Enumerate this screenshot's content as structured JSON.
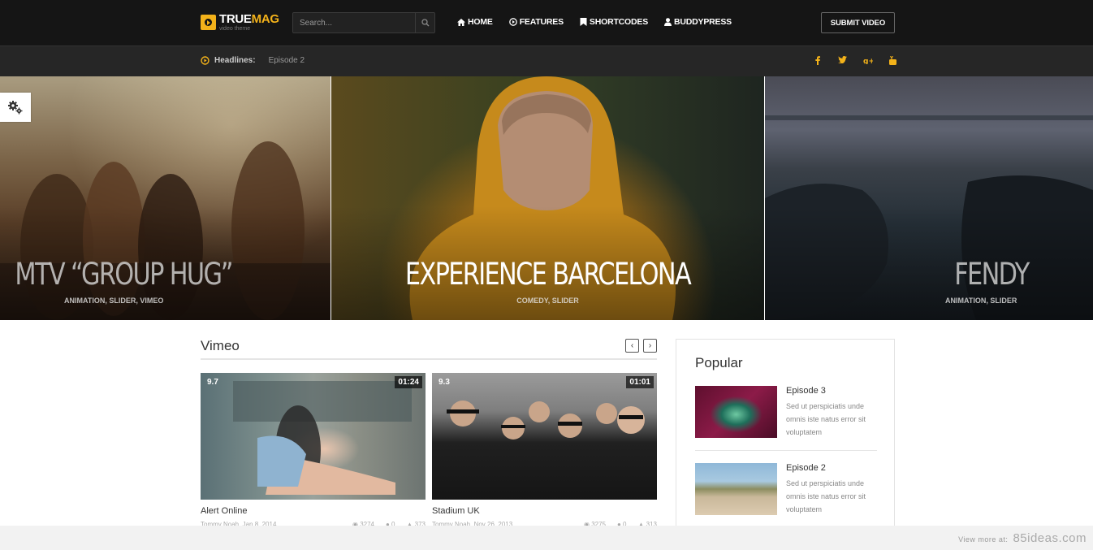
{
  "header": {
    "logo_true": "TRUE",
    "logo_mag": "MAG",
    "logo_tagline": "video theme",
    "search_placeholder": "Search...",
    "nav": [
      {
        "label": "HOME",
        "icon": "home-icon"
      },
      {
        "label": "FEATURES",
        "icon": "play-circle-icon"
      },
      {
        "label": "SHORTCODES",
        "icon": "bookmark-icon"
      },
      {
        "label": "BUDDYPRESS",
        "icon": "user-icon"
      }
    ],
    "submit_label": "SUBMIT VIDEO"
  },
  "headlines": {
    "label": "Headlines:",
    "item": "Episode 2",
    "social": [
      "facebook-icon",
      "twitter-icon",
      "google-plus-icon",
      "youtube-icon"
    ]
  },
  "slider": [
    {
      "title": "MTV “GROUP HUG”",
      "cats": "ANIMATION, SLIDER, VIMEO"
    },
    {
      "title": "EXPERIENCE BARCELONA",
      "cats": "COMEDY, SLIDER"
    },
    {
      "title": "FENDY",
      "cats": "ANIMATION, SLIDER"
    }
  ],
  "vimeo": {
    "title": "Vimeo",
    "videos": [
      {
        "rating": "9.7",
        "duration": "01:24",
        "title": "Alert Online",
        "author": "Tommy Noah",
        "date": "Jan 8, 2014",
        "views": "3274",
        "comments": "0",
        "likes": "373"
      },
      {
        "rating": "9.3",
        "duration": "01:01",
        "title": "Stadium UK",
        "author": "Tommy Noah",
        "date": "Nov 26, 2013",
        "views": "3275",
        "comments": "0",
        "likes": "313"
      }
    ]
  },
  "popular": {
    "title": "Popular",
    "items": [
      {
        "title": "Episode 3",
        "desc": "Sed ut perspiciatis unde omnis iste natus error sit voluptatem"
      },
      {
        "title": "Episode 2",
        "desc": "Sed ut perspiciatis unde omnis iste natus error sit voluptatem"
      }
    ]
  },
  "watermark": {
    "prefix": "View more at:",
    "site": "85ideas.com"
  },
  "colors": {
    "accent": "#f3b21a",
    "topbar": "#151515",
    "headbar": "#262626"
  }
}
